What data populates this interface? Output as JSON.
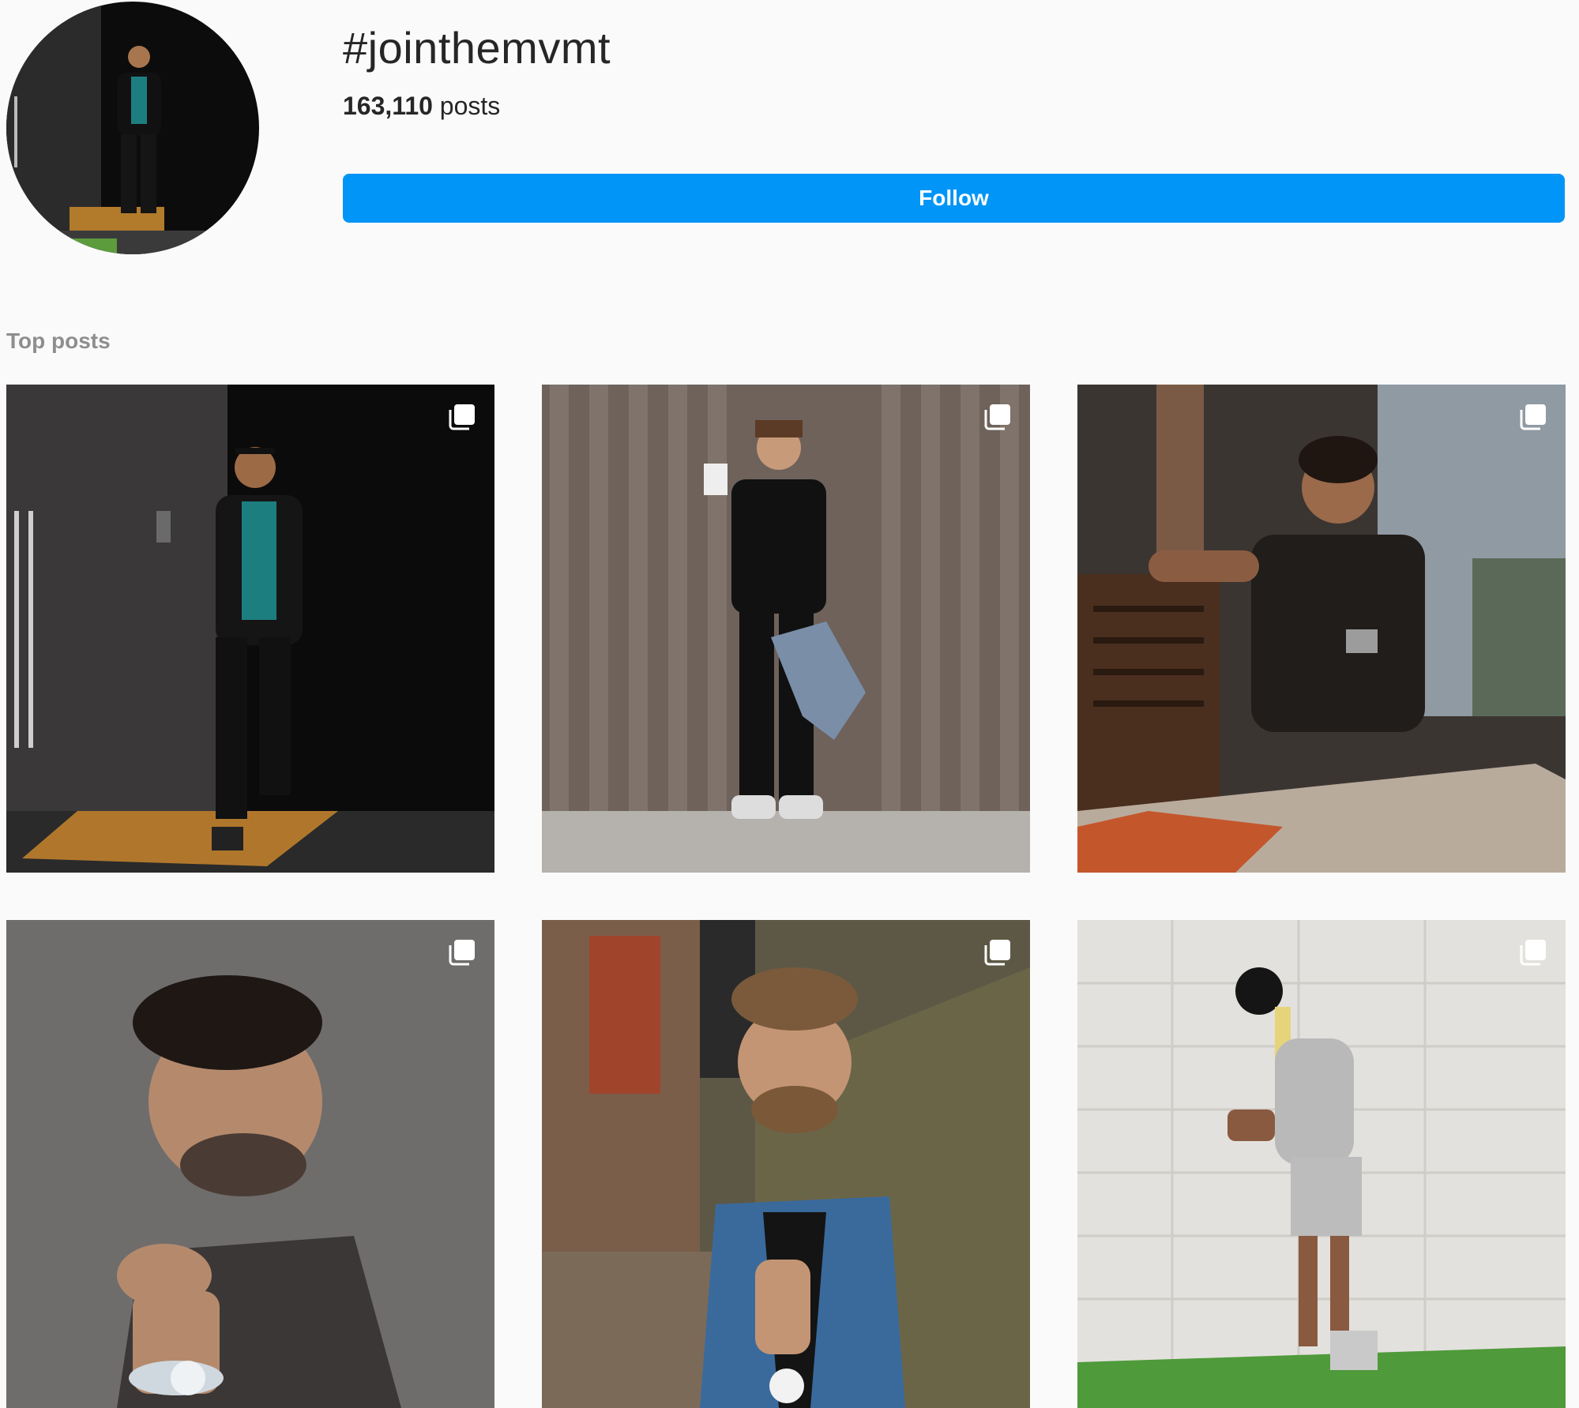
{
  "header": {
    "hashtag": "#jointhemvmt",
    "post_count": "163,110",
    "post_count_suffix": "posts",
    "follow_label": "Follow"
  },
  "section": {
    "top_posts_label": "Top posts"
  },
  "posts": [
    {
      "description": "man in black blazer and teal t-shirt in dark doorway",
      "icon": "multiple-photos-icon"
    },
    {
      "description": "man in black t-shirt drinking coffee holding denim jacket",
      "icon": "multiple-photos-icon"
    },
    {
      "description": "man in black shirt seated at cafe table wearing watch",
      "icon": "multiple-photos-icon"
    },
    {
      "description": "man with beard in grey sweater touching chin wearing white watch",
      "icon": "multiple-photos-icon"
    },
    {
      "description": "man in denim jacket in front of stone wall wearing white watch",
      "icon": "multiple-photos-icon"
    },
    {
      "description": "man in grey hoodie and beanie on turf checking watch",
      "icon": "multiple-photos-icon"
    }
  ],
  "colors": {
    "accent": "#0095f6",
    "background": "#fafafa",
    "text": "#262626",
    "muted": "#8e8e8e"
  }
}
